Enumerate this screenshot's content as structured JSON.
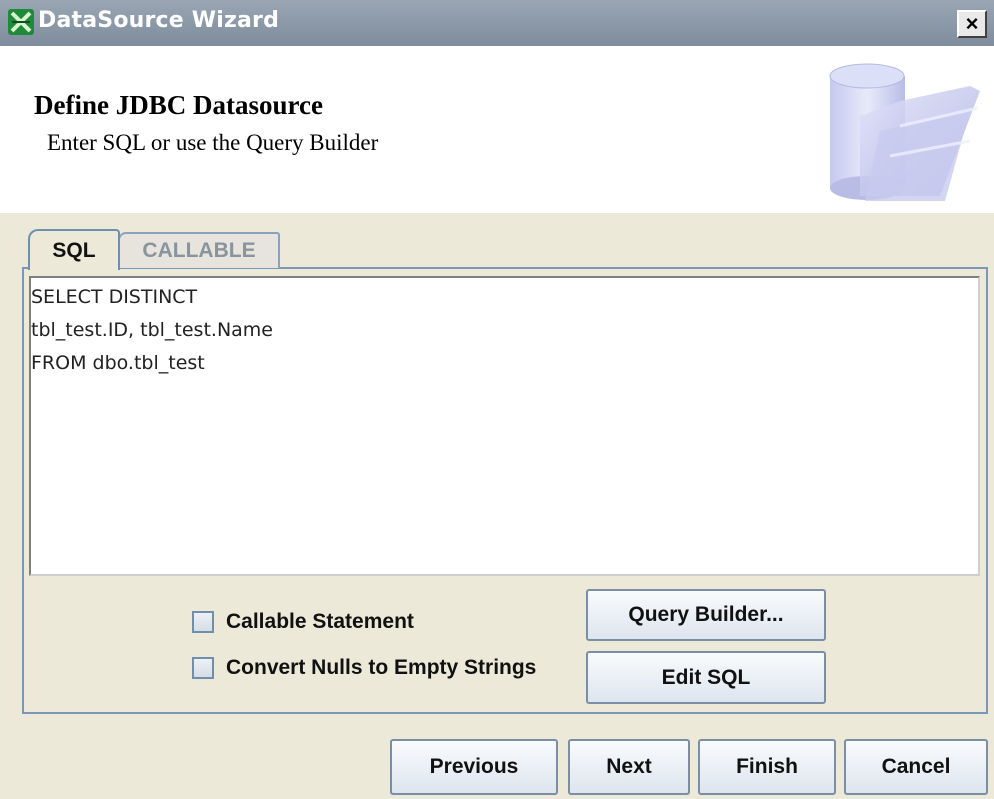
{
  "window": {
    "title": "DataSource Wizard",
    "close_glyph": "×"
  },
  "header": {
    "title": "Define JDBC Datasource",
    "subtitle": "Enter SQL or use the Query Builder",
    "graphic_icon": "database-folder-icon"
  },
  "tabs": [
    {
      "label": "SQL",
      "selected": true
    },
    {
      "label": "CALLABLE",
      "selected": false
    }
  ],
  "sql": {
    "lines": [
      "SELECT DISTINCT",
      "tbl_test.ID, tbl_test.Name",
      "FROM dbo.tbl_test"
    ]
  },
  "options": {
    "callable_label": "Callable Statement",
    "callable_checked": false,
    "convert_nulls_label": "Convert Nulls to Empty Strings",
    "convert_nulls_checked": false
  },
  "buttons": {
    "query_builder": "Query Builder...",
    "edit_sql": "Edit SQL",
    "previous": "Previous",
    "next": "Next",
    "finish": "Finish",
    "cancel": "Cancel"
  }
}
